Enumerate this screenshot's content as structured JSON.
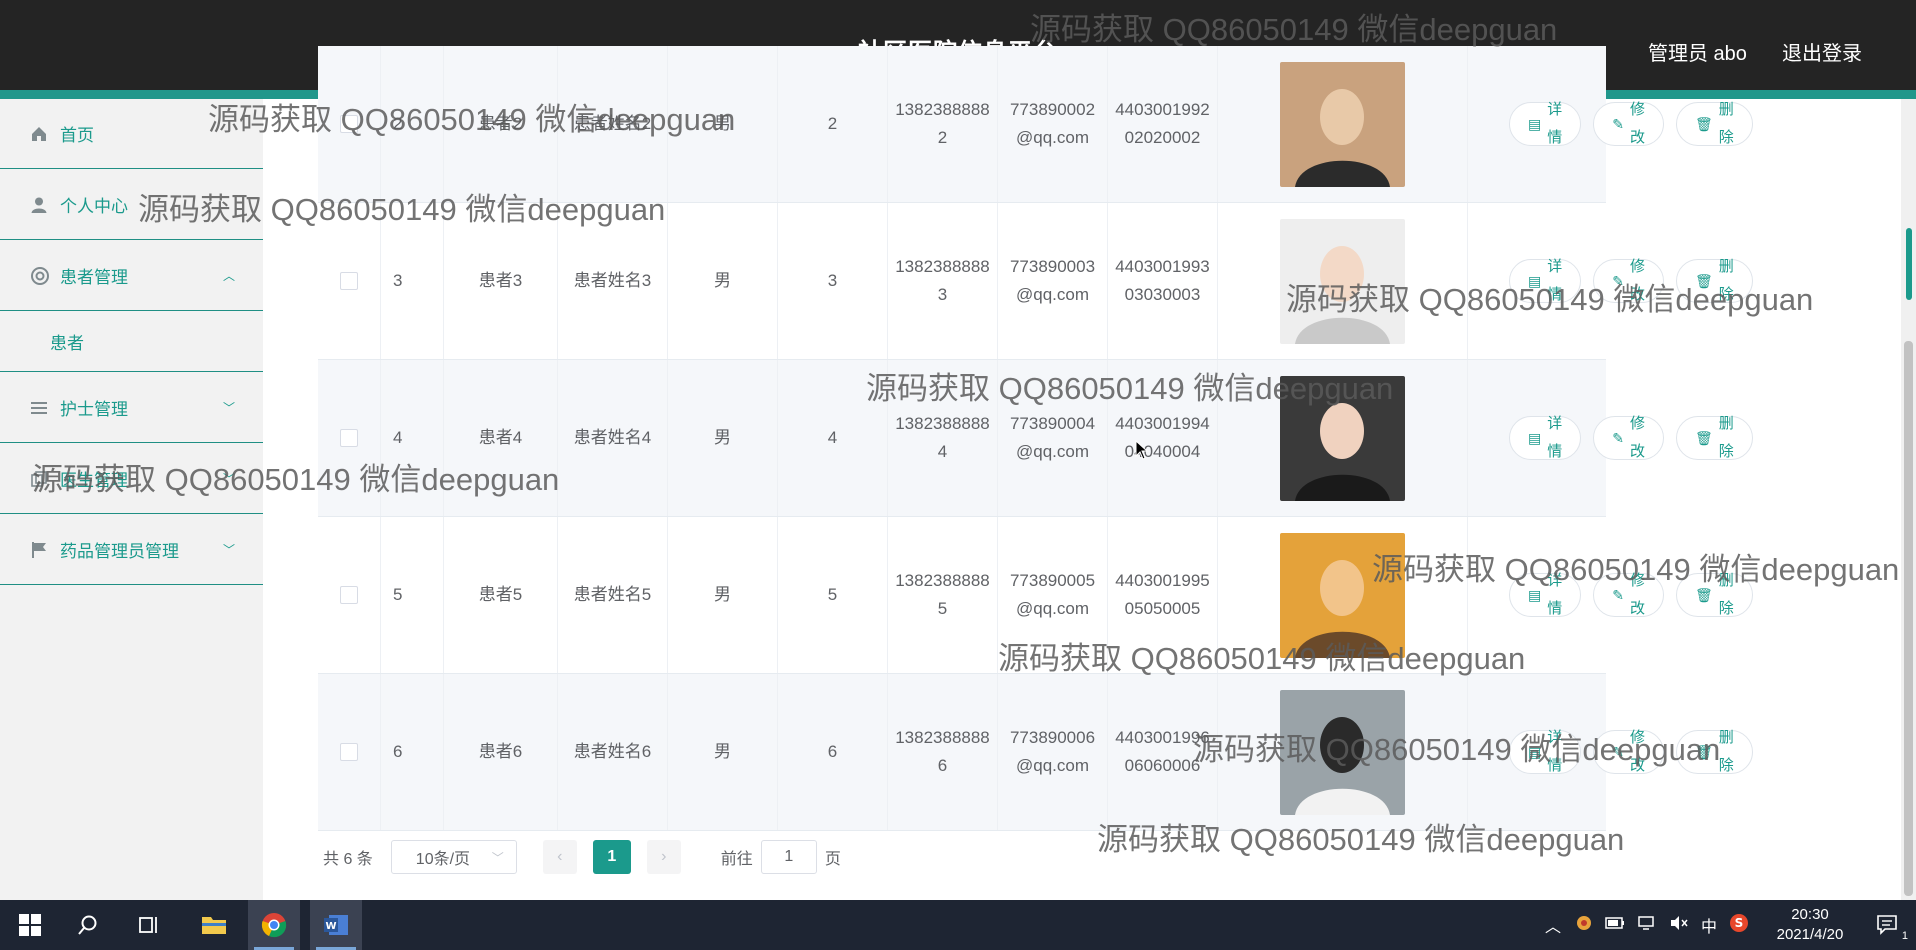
{
  "header": {
    "title": "社区医院信息平台",
    "admin": "管理员 abo",
    "logout": "退出登录"
  },
  "sidebar": {
    "items": [
      {
        "label": "首页",
        "icon": "home-icon"
      },
      {
        "label": "个人中心",
        "icon": "user-icon"
      },
      {
        "label": "患者管理",
        "icon": "lifebuoy-icon",
        "expanded": true
      },
      {
        "label": "患者",
        "sub": true
      },
      {
        "label": "护士管理",
        "icon": "list-icon"
      },
      {
        "label": "医生管理",
        "icon": "copy-icon"
      },
      {
        "label": "药品管理员管理",
        "icon": "flag-icon"
      }
    ]
  },
  "table": {
    "rows": [
      {
        "id": "2",
        "account": "患者2",
        "name": "患者姓名2",
        "gender": "男",
        "age": "2",
        "phone": "13823888882",
        "email": "773890002@qq.com",
        "idcard": "440300199202020002"
      },
      {
        "id": "3",
        "account": "患者3",
        "name": "患者姓名3",
        "gender": "男",
        "age": "3",
        "phone": "13823888883",
        "email": "773890003@qq.com",
        "idcard": "440300199303030003"
      },
      {
        "id": "4",
        "account": "患者4",
        "name": "患者姓名4",
        "gender": "男",
        "age": "4",
        "phone": "13823888884",
        "email": "773890004@qq.com",
        "idcard": "440300199404040004"
      },
      {
        "id": "5",
        "account": "患者5",
        "name": "患者姓名5",
        "gender": "男",
        "age": "5",
        "phone": "13823888885",
        "email": "773890005@qq.com",
        "idcard": "440300199505050005"
      },
      {
        "id": "6",
        "account": "患者6",
        "name": "患者姓名6",
        "gender": "男",
        "age": "6",
        "phone": "13823888886",
        "email": "773890006@qq.com",
        "idcard": "440300199606060006"
      }
    ],
    "actions": {
      "detail": "详情",
      "edit": "修改",
      "delete": "删除"
    }
  },
  "pagination": {
    "total": "共 6 条",
    "page_size": "10条/页",
    "current": "1",
    "goto_label": "前往",
    "goto_value": "1",
    "page_unit": "页"
  },
  "watermark": "源码获取 QQ86050149 微信deepguan",
  "taskbar": {
    "time": "20:30",
    "date": "2021/4/20",
    "ime": "中",
    "notification_count": "1"
  },
  "colors": {
    "accent": "#1b9a8c",
    "header_bg": "#242424",
    "taskbar_bg": "#1e2533"
  }
}
